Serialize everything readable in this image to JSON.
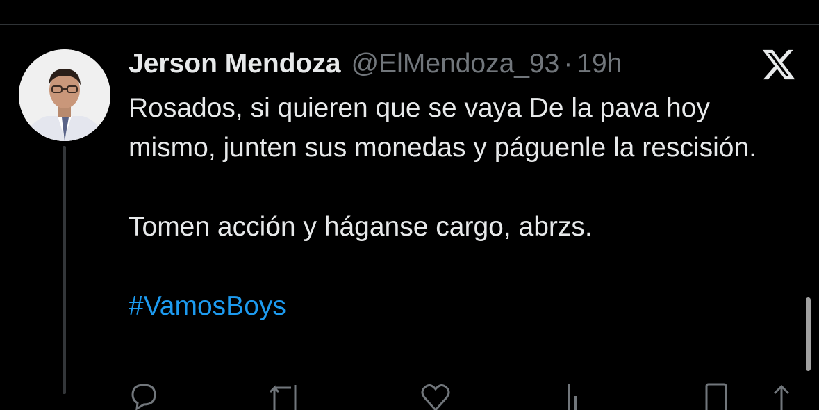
{
  "tweet": {
    "author_name": "Jerson Mendoza",
    "author_handle": "@ElMendoza_93",
    "separator": "·",
    "timestamp": "19h",
    "paragraphs": [
      "Rosados, si quieren que se vaya De la pava hoy mismo, junten sus monedas y páguenle la rescisión.",
      "Tomen acción y háganse cargo, abrzs."
    ],
    "hashtag": "#VamosBoys"
  },
  "actions": {
    "reply_icon": "reply-icon",
    "retweet_icon": "retweet-icon",
    "like_icon": "heart-icon",
    "views_icon": "views-icon",
    "bookmark_icon": "bookmark-icon",
    "share_icon": "share-icon"
  },
  "colors": {
    "background": "#000000",
    "text": "#e7e9ea",
    "secondary_text": "#71767b",
    "link": "#1d9bf0",
    "divider": "#2f3336"
  },
  "logo": "x-logo"
}
